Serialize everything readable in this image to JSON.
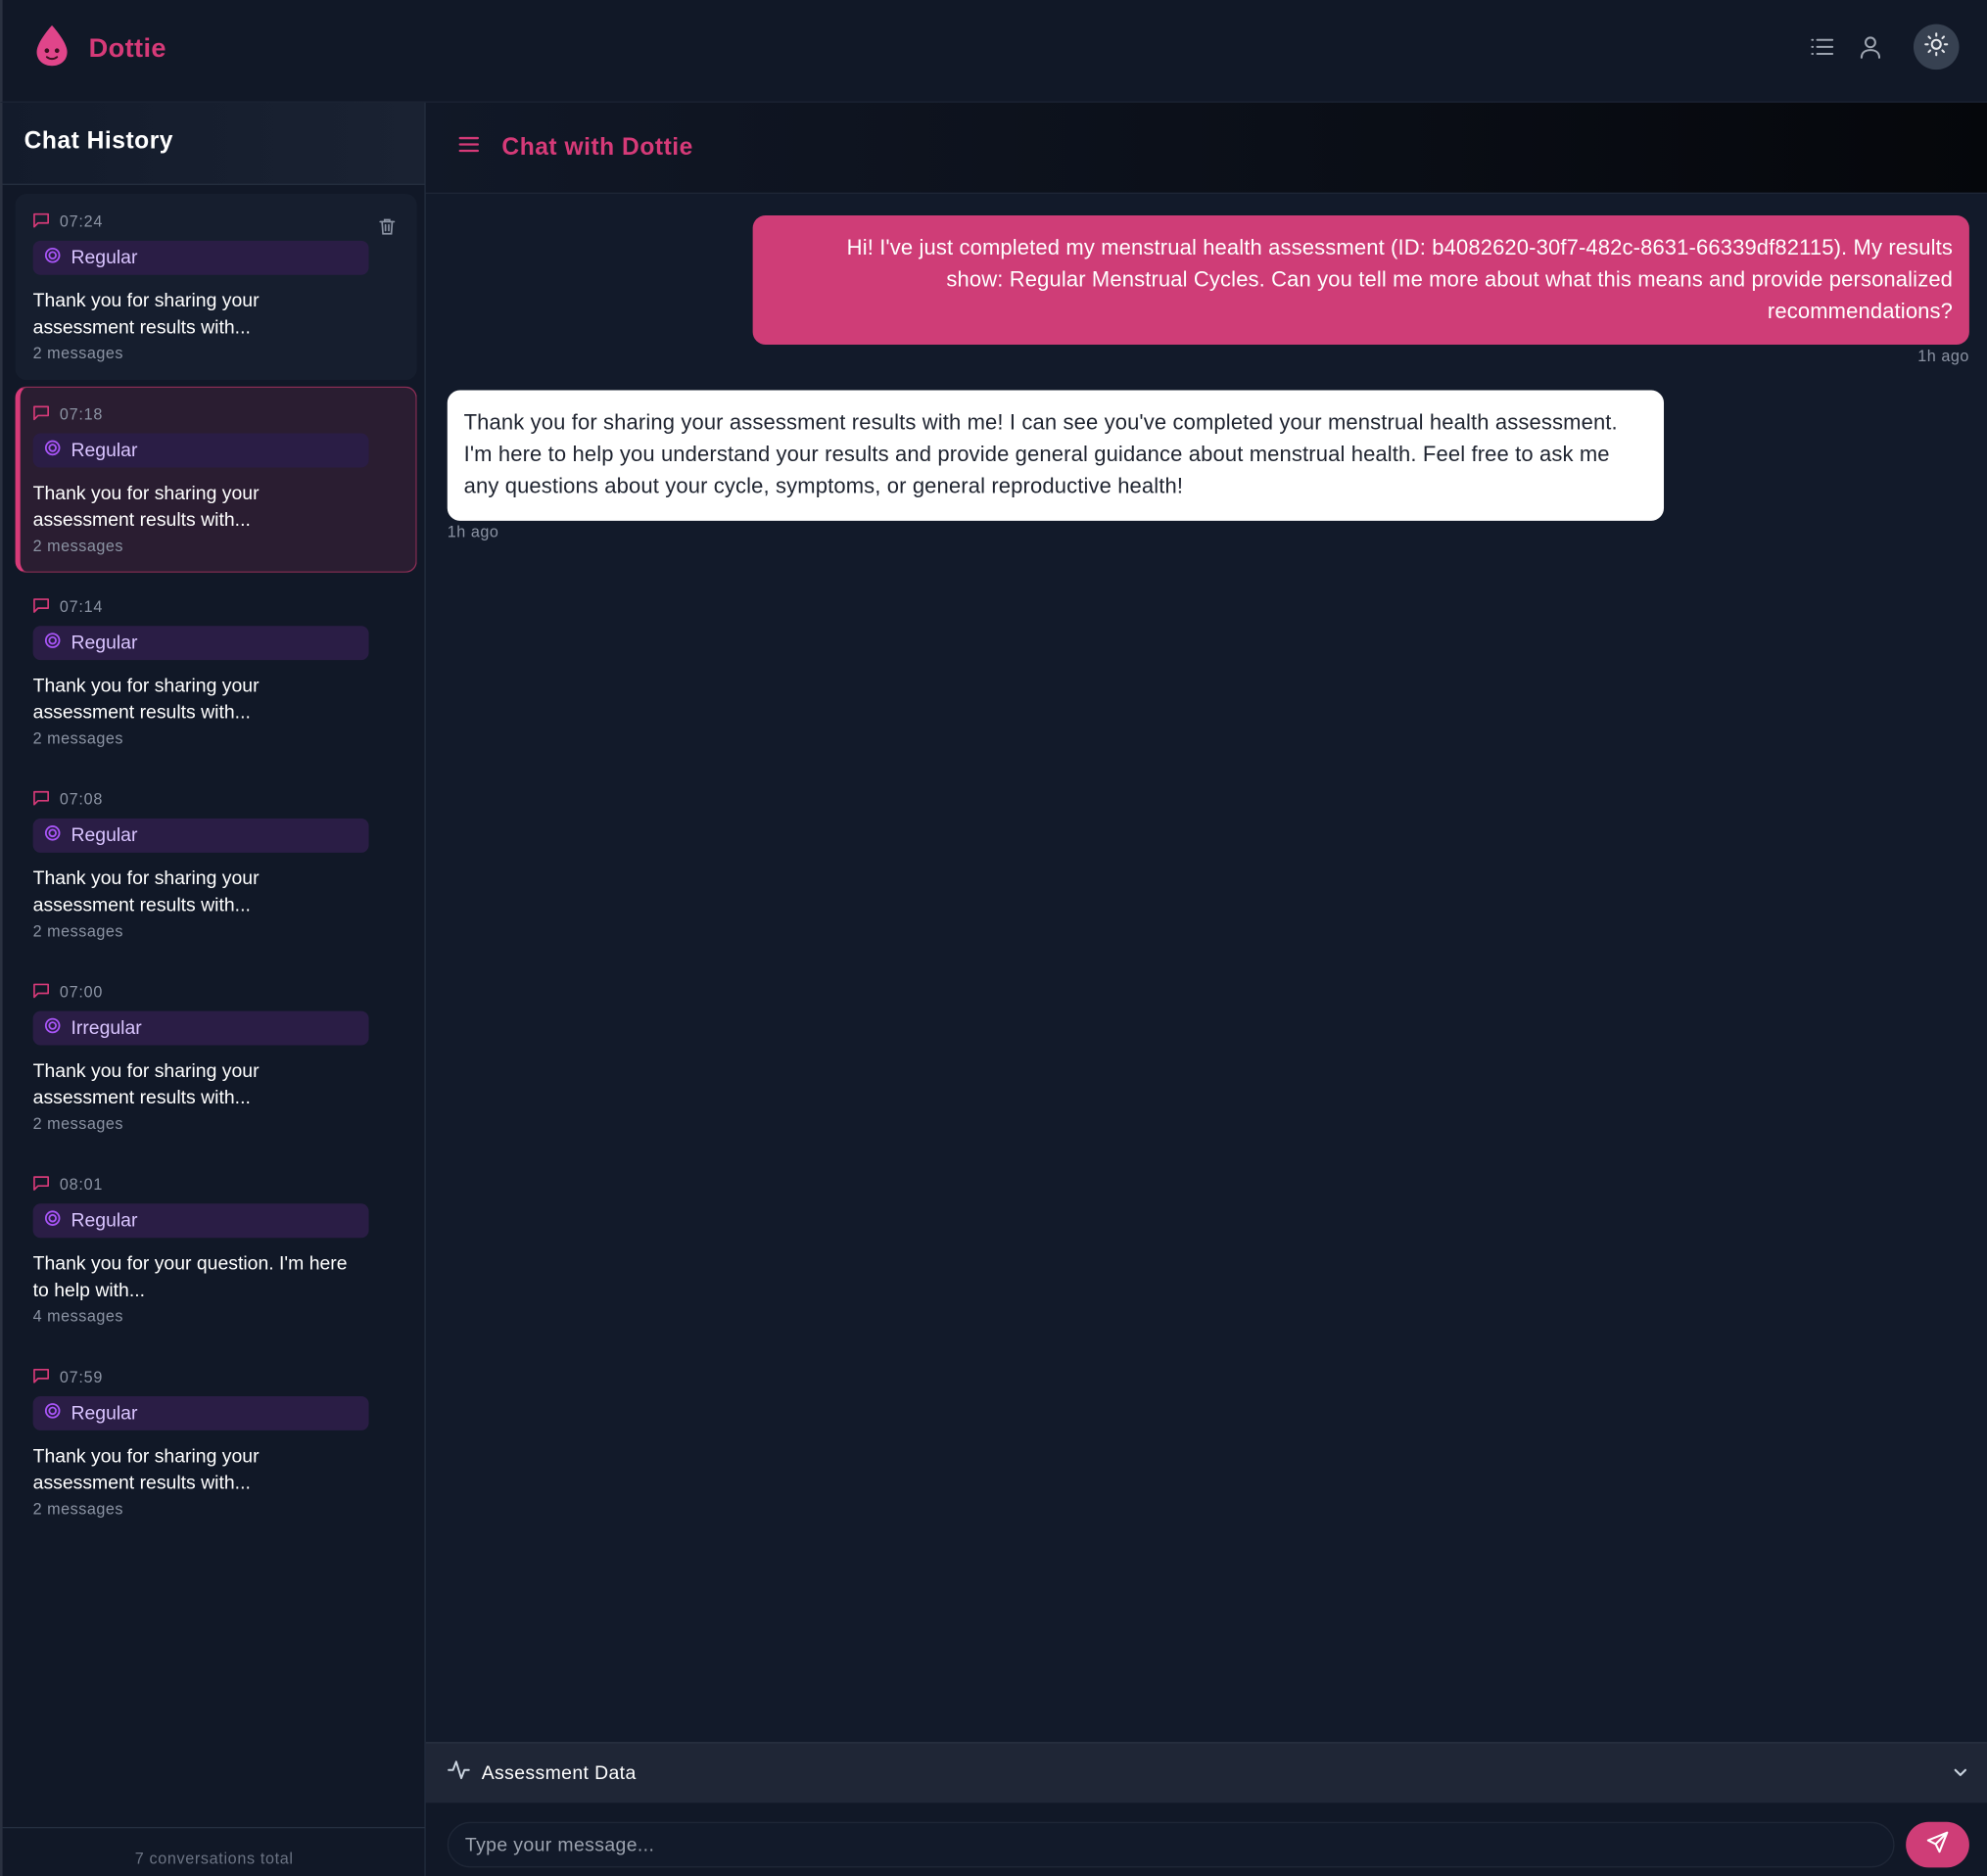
{
  "app": {
    "name": "Dottie"
  },
  "colors": {
    "brand": "#d63a78",
    "user_bubble": "#cf3d77",
    "badge_bg": "#2a1d45",
    "badge_text": "#d9c4ff"
  },
  "sidebar": {
    "title": "Chat History",
    "footer": "7 conversations total",
    "conversations": [
      {
        "time": "07:24",
        "badge": "Regular",
        "preview": "Thank you for sharing your assessment results with...",
        "count": "2 messages"
      },
      {
        "time": "07:18",
        "badge": "Regular",
        "preview": "Thank you for sharing your assessment results with...",
        "count": "2 messages"
      },
      {
        "time": "07:14",
        "badge": "Regular",
        "preview": "Thank you for sharing your assessment results with...",
        "count": "2 messages"
      },
      {
        "time": "07:08",
        "badge": "Regular",
        "preview": "Thank you for sharing your assessment results with...",
        "count": "2 messages"
      },
      {
        "time": "07:00",
        "badge": "Irregular",
        "preview": "Thank you for sharing your assessment results with...",
        "count": "2 messages"
      },
      {
        "time": "08:01",
        "badge": "Regular",
        "preview": "Thank you for your question. I'm here to help with...",
        "count": "4 messages"
      },
      {
        "time": "07:59",
        "badge": "Regular",
        "preview": "Thank you for sharing your assessment results with...",
        "count": "2 messages"
      }
    ]
  },
  "chat": {
    "title": "Chat with Dottie",
    "messages": [
      {
        "role": "user",
        "text": "Hi! I've just completed my menstrual health assessment (ID: b4082620-30f7-482c-8631-66339df82115). My results show: Regular Menstrual Cycles. Can you tell me more about what this means and provide personalized recommendations?",
        "time": "1h ago"
      },
      {
        "role": "assistant",
        "text": "Thank you for sharing your assessment results with me! I can see you've completed your menstrual health assessment. I'm here to help you understand your results and provide general guidance about menstrual health. Feel free to ask me any questions about your cycle, symptoms, or general reproductive health!",
        "time": "1h ago"
      }
    ],
    "assessment_label": "Assessment Data",
    "input_placeholder": "Type your message..."
  },
  "icons": {
    "logo": "droplet-face-icon",
    "list": "list-icon",
    "user": "user-icon",
    "theme": "sun-icon",
    "menu": "hamburger-icon",
    "conversation": "message-square-icon",
    "badge": "target-icon",
    "delete": "trash-icon",
    "assessment": "activity-icon",
    "expand": "chevron-down-icon",
    "send": "send-icon"
  }
}
